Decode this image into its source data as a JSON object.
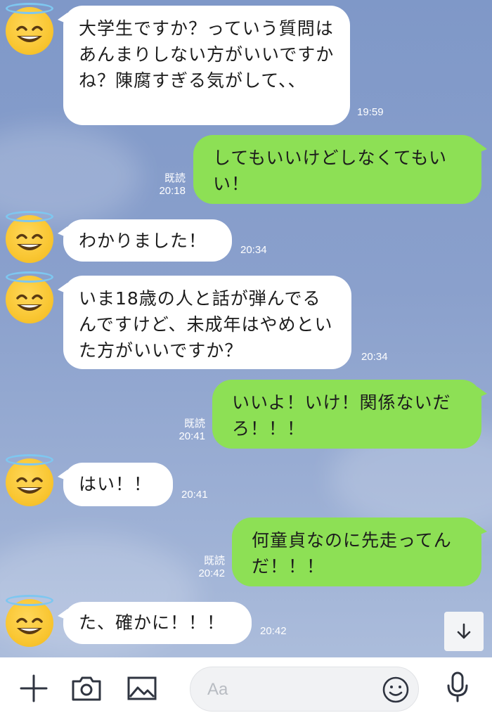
{
  "messages": [
    {
      "side": "in",
      "text": "大学生ですか？っていう質問はあんまりしない方がいいですかね？陳腐すぎる気がして、、",
      "time": "19:59"
    },
    {
      "side": "out",
      "text": "してもいいけどしなくてもいい！",
      "read": "既読",
      "time": "20:18"
    },
    {
      "side": "in",
      "text": "わかりました！",
      "time": "20:34"
    },
    {
      "side": "in",
      "text": "いま18歳の人と話が弾んでるんですけど、未成年はやめといた方がいいですか？",
      "time": "20:34"
    },
    {
      "side": "out",
      "text": "いいよ！いけ！関係ないだろ！！！",
      "read": "既読",
      "time": "20:41"
    },
    {
      "side": "in",
      "text": "はい！！",
      "time": "20:41"
    },
    {
      "side": "out",
      "text": "何童貞なのに先走ってんだ！！！",
      "read": "既読",
      "time": "20:42"
    },
    {
      "side": "in",
      "text": "た、確かに！！！",
      "time": "20:42"
    }
  ],
  "input": {
    "placeholder": "Aa"
  },
  "icons": {
    "add": "plus-icon",
    "camera": "camera-icon",
    "image": "image-icon",
    "emoji": "smiley-icon",
    "mic": "microphone-icon",
    "scroll": "arrow-down-icon"
  },
  "colors": {
    "outgoing_bubble": "#8de055",
    "incoming_bubble": "#ffffff",
    "halo": "#7ec7f0",
    "avatar": "#f9c632"
  }
}
